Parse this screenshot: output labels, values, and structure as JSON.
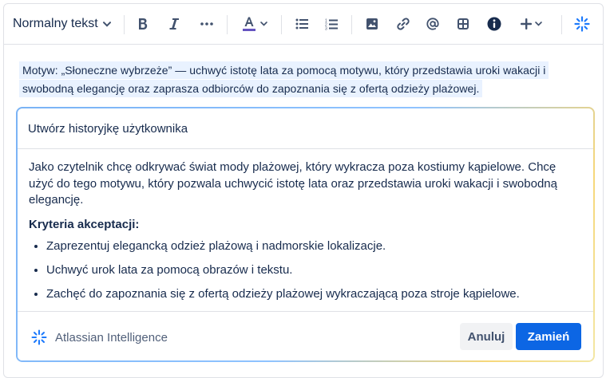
{
  "toolbar": {
    "text_style": "Normalny tekst",
    "buttons": [
      {
        "name": "bold-icon"
      },
      {
        "name": "italic-icon"
      },
      {
        "name": "more-formatting-icon"
      },
      {
        "name": "text-color-icon"
      },
      {
        "name": "bullet-list-icon"
      },
      {
        "name": "numbered-list-icon"
      },
      {
        "name": "image-icon"
      },
      {
        "name": "link-icon"
      },
      {
        "name": "mention-icon"
      },
      {
        "name": "table-icon"
      },
      {
        "name": "info-icon"
      },
      {
        "name": "insert-plus-icon"
      },
      {
        "name": "atlassian-intelligence-icon"
      }
    ],
    "accent_color": "#0C66E4",
    "text_color_underline": "#6554C0"
  },
  "editor": {
    "selected_text": "Motyw: „Słoneczne wybrzeże” — uchwyć istotę lata za pomocą motywu, który przedstawia uroki wakacji i swobodną elegancję oraz zaprasza odbiorców do zapoznania się z ofertą odzieży plażowej."
  },
  "ai_panel": {
    "prompt": "Utwórz historyjkę użytkownika",
    "result": {
      "story": "Jako czytelnik chcę odkrywać świat mody plażowej, który wykracza poza kostiumy kąpielowe. Chcę użyć do tego motywu, który pozwala uchwycić istotę lata oraz przedstawia uroki wakacji i swobodną elegancję.",
      "criteria_heading": "Kryteria akceptacji:",
      "criteria": [
        "Zaprezentuj elegancką odzież plażową i nadmorskie lokalizacje.",
        "Uchwyć urok lata za pomocą obrazów i tekstu.",
        "Zachęć do zapoznania się z ofertą odzieży plażowej wykraczającą poza stroje kąpielowe."
      ]
    },
    "brand": "Atlassian Intelligence",
    "cancel_label": "Anuluj",
    "replace_label": "Zamień"
  }
}
